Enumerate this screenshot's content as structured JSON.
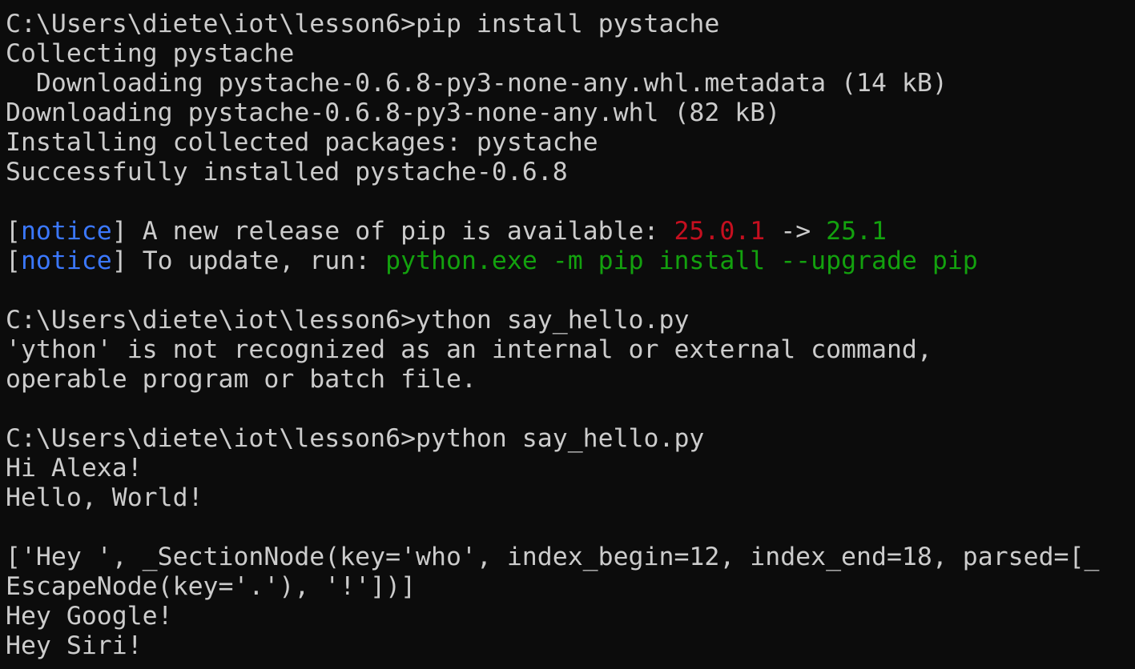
{
  "terminal": {
    "prompt": "C:\\Users\\diete\\iot\\lesson6>",
    "colors": {
      "background": "#0c0c0c",
      "foreground": "#cccccc",
      "notice": "#3b78ff",
      "old_version": "#c50f1f",
      "new_version": "#13a10e"
    },
    "cmd1": "pip install pystache",
    "out1": "Collecting pystache",
    "out2": "  Downloading pystache-0.6.8-py3-none-any.whl.metadata (14 kB)",
    "out3": "Downloading pystache-0.6.8-py3-none-any.whl (82 kB)",
    "out4": "Installing collected packages: pystache",
    "out5": "Successfully installed pystache-0.6.8",
    "notice1": {
      "open": "[",
      "tag": "notice",
      "close": "]",
      "text": " A new release of pip is available: ",
      "old": "25.0.1",
      "arrow": " -> ",
      "new": "25.1"
    },
    "notice2": {
      "open": "[",
      "tag": "notice",
      "close": "]",
      "text": " To update, run: ",
      "cmd": "python.exe -m pip install --upgrade pip"
    },
    "cmd2": "ython say_hello.py",
    "err1": "'ython' is not recognized as an internal or external command,",
    "err2": "operable program or batch file.",
    "cmd3": "python say_hello.py",
    "out6": "Hi Alexa!",
    "out7": "Hello, World!",
    "out8": "['Hey ', _SectionNode(key='who', index_begin=12, index_end=18, parsed=[_",
    "out9": "EscapeNode(key='.'), '!'])]",
    "out10": "Hey Google!",
    "out11": "Hey Siri!"
  }
}
